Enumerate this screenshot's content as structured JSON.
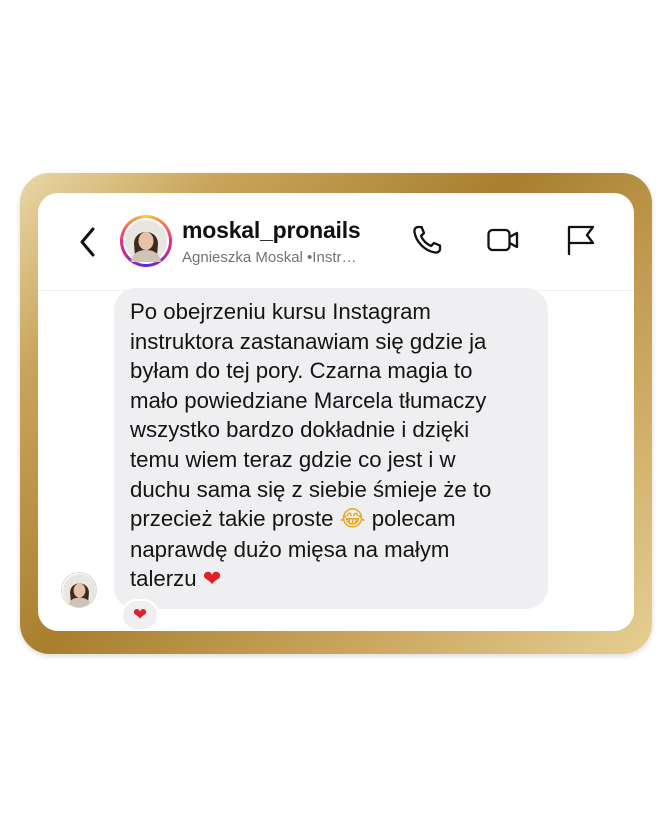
{
  "header": {
    "username": "moskal_pronails",
    "subtitle": "Agnieszka Moskal •Instr…"
  },
  "icons": {
    "back": "chevron-left-icon",
    "call": "phone-icon",
    "video": "video-camera-icon",
    "report": "flag-icon"
  },
  "message": {
    "lines": [
      "Po obejrzeniu kursu Instagram",
      "instruktora zastanawiam się gdzie ja",
      "byłam do tej pory. Czarna magia to",
      "mało powiedziane Marcela tłumaczy",
      "wszystko bardzo dokładnie i dzięki",
      "temu wiem teraz gdzie co jest i w",
      "duchu sama się z siebie śmieje że to"
    ],
    "line8_before": "przecież takie proste",
    "line8_emoji": "😂",
    "line8_after": "polecam",
    "line9": "naprawdę dużo mięsa na małym",
    "line10_text": "talerzu",
    "line10_emoji": "❤",
    "reaction": "❤"
  },
  "colors": {
    "bubble": "#efeff2",
    "heart": "#e0212b",
    "gold_frame": "#b8913f"
  }
}
